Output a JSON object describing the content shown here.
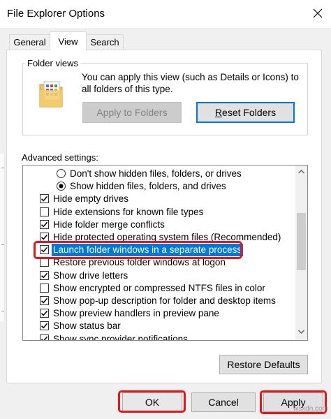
{
  "window": {
    "title": "File Explorer Options"
  },
  "tabs": [
    {
      "label": "General",
      "active": false
    },
    {
      "label": "View",
      "active": true
    },
    {
      "label": "Search",
      "active": false
    }
  ],
  "folder_views": {
    "title": "Folder views",
    "description": "You can apply this view (such as Details or Icons) to all folders of this type.",
    "apply_label": "Apply to Folders",
    "reset_label": "Reset Folders",
    "reset_accel": "R"
  },
  "advanced": {
    "label": "Advanced settings:",
    "items": [
      {
        "type": "radio",
        "checked": false,
        "label": "Don't show hidden files, folders, or drives"
      },
      {
        "type": "radio",
        "checked": true,
        "label": "Show hidden files, folders, and drives"
      },
      {
        "type": "checkbox",
        "checked": true,
        "label": "Hide empty drives"
      },
      {
        "type": "checkbox",
        "checked": false,
        "label": "Hide extensions for known file types"
      },
      {
        "type": "checkbox",
        "checked": true,
        "label": "Hide folder merge conflicts"
      },
      {
        "type": "checkbox",
        "checked": true,
        "label": "Hide protected operating system files (Recommended)"
      },
      {
        "type": "checkbox",
        "checked": true,
        "label": "Launch folder windows in a separate process",
        "selected": true
      },
      {
        "type": "checkbox",
        "checked": false,
        "label": "Restore previous folder windows at logon"
      },
      {
        "type": "checkbox",
        "checked": true,
        "label": "Show drive letters"
      },
      {
        "type": "checkbox",
        "checked": false,
        "label": "Show encrypted or compressed NTFS files in color"
      },
      {
        "type": "checkbox",
        "checked": true,
        "label": "Show pop-up description for folder and desktop items"
      },
      {
        "type": "checkbox",
        "checked": true,
        "label": "Show preview handlers in preview pane"
      },
      {
        "type": "checkbox",
        "checked": true,
        "label": "Show status bar"
      },
      {
        "type": "checkbox",
        "checked": true,
        "label": "Show sync provider notifications"
      }
    ],
    "restore_defaults_label": "Restore Defaults"
  },
  "footer": {
    "ok_label": "OK",
    "cancel_label": "Cancel",
    "apply_label": "Apply"
  },
  "watermark": "wsxdn.com",
  "colors": {
    "selection": "#0078d7",
    "highlight_box": "#e8161c",
    "focus_border": "#0078d7"
  },
  "icons": {
    "close": "close-icon",
    "folder": "folder-icon",
    "checkmark": "checkmark-icon",
    "scroll_up": "chevron-up-icon",
    "scroll_down": "chevron-down-icon"
  }
}
